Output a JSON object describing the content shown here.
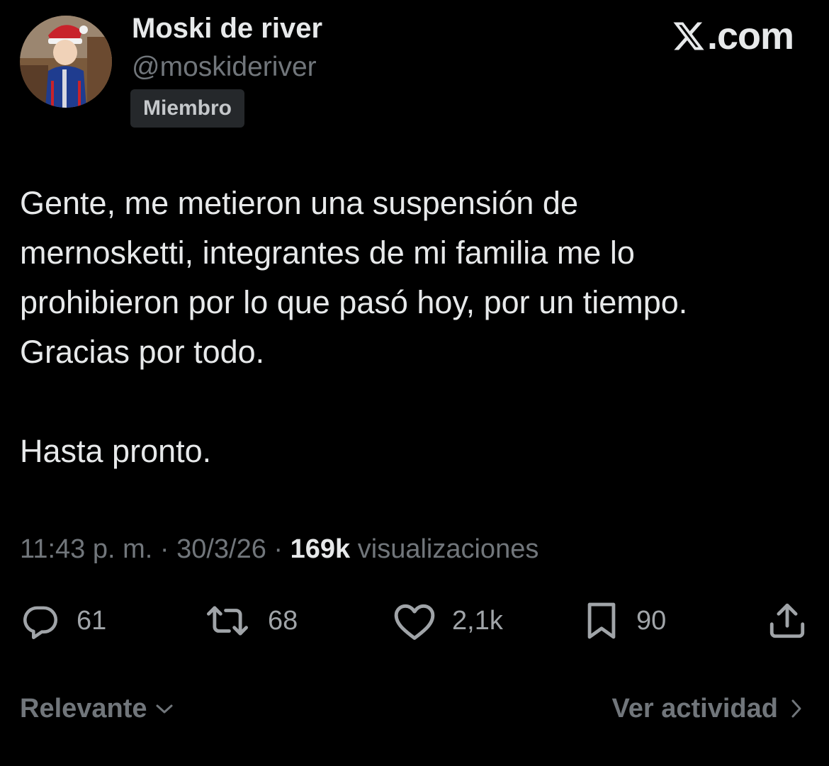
{
  "author": {
    "display_name": "Moski de river",
    "handle": "@moskideriver",
    "badge": "Miembro"
  },
  "brand": {
    "label": ".com",
    "icon": "x-logo-icon"
  },
  "tweet": {
    "lines": [
      "Gente, me metieron una suspensión de",
      "mernosketti, integrantes de mi familia me lo",
      "prohibieron por lo que pasó hoy, por un tiempo.",
      "Gracias por todo."
    ],
    "closing": "Hasta pronto."
  },
  "meta": {
    "time": "11:43 p. m.",
    "separator": " · ",
    "date": "30/3/26",
    "views_count": "169k",
    "views_label": "visualizaciones"
  },
  "actions": {
    "replies": {
      "icon": "reply-icon",
      "count": "61"
    },
    "reposts": {
      "icon": "repost-icon",
      "count": "68"
    },
    "likes": {
      "icon": "heart-icon",
      "count": "2,1k"
    },
    "bookmarks": {
      "icon": "bookmark-icon",
      "count": "90"
    },
    "share": {
      "icon": "share-icon"
    }
  },
  "footer": {
    "sort_label": "Relevante",
    "activity_label": "Ver actividad"
  },
  "colors": {
    "background": "#000000",
    "text_primary": "#e7e9ea",
    "text_secondary": "#71767b",
    "icon": "#a0a4a8",
    "badge_bg": "#25282b"
  }
}
